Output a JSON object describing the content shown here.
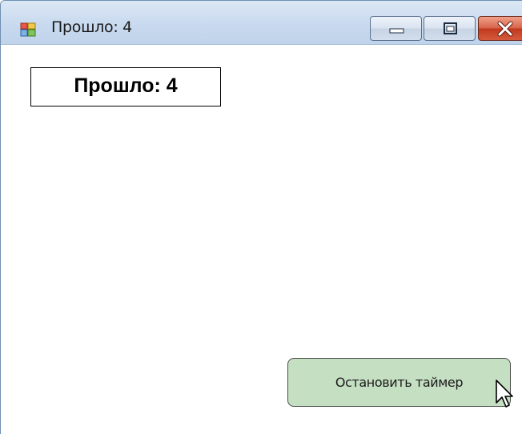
{
  "window": {
    "title": "Прошло: 4",
    "icon": "app-window-icon",
    "controls": {
      "minimize_icon": "minimize-icon",
      "maximize_icon": "maximize-icon",
      "close_icon": "close-icon"
    }
  },
  "main": {
    "elapsed_label": "Прошло: 4",
    "stop_button_label": "Остановить таймер"
  },
  "colors": {
    "titlebar": "#c9daef",
    "close_button": "#c0391f",
    "stop_button": "#c5dfc2",
    "label_border": "#000000"
  },
  "cursor": {
    "icon": "mouse-pointer-icon"
  }
}
